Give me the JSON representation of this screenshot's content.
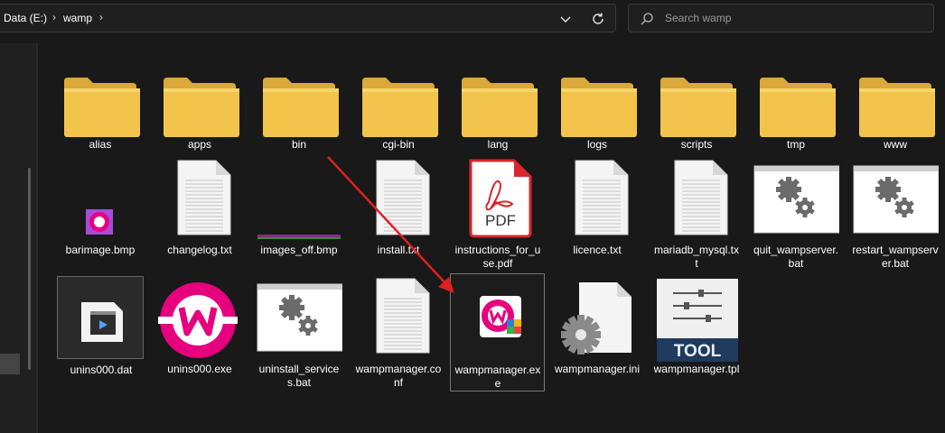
{
  "address_bar": {
    "drive_label": "Data (E:)",
    "folder_label": "wamp",
    "separator": "›"
  },
  "search": {
    "placeholder": "Search wamp"
  },
  "items": [
    {
      "name": "alias",
      "type": "folder"
    },
    {
      "name": "apps",
      "type": "folder"
    },
    {
      "name": "bin",
      "type": "folder"
    },
    {
      "name": "cgi-bin",
      "type": "folder"
    },
    {
      "name": "lang",
      "type": "folder"
    },
    {
      "name": "logs",
      "type": "folder"
    },
    {
      "name": "scripts",
      "type": "folder"
    },
    {
      "name": "tmp",
      "type": "folder"
    },
    {
      "name": "www",
      "type": "folder"
    },
    {
      "name": "barimage.bmp",
      "type": "bmp-wamp"
    },
    {
      "name": "changelog.txt",
      "type": "text"
    },
    {
      "name": "images_off.bmp",
      "type": "bmp-strip"
    },
    {
      "name": "install.txt",
      "type": "text"
    },
    {
      "name": "instructions_for_use.pdf",
      "type": "pdf",
      "badge": "PDF"
    },
    {
      "name": "licence.txt",
      "type": "text"
    },
    {
      "name": "mariadb_mysql.txt",
      "type": "text"
    },
    {
      "name": "quit_wampserver.bat",
      "type": "batch"
    },
    {
      "name": "restart_wampserver.bat",
      "type": "batch"
    },
    {
      "name": "unins000.dat",
      "type": "video"
    },
    {
      "name": "unins000.exe",
      "type": "wamp-logo"
    },
    {
      "name": "uninstall_services.bat",
      "type": "batch"
    },
    {
      "name": "wampmanager.conf",
      "type": "text"
    },
    {
      "name": "wampmanager.exe",
      "type": "wamp-app"
    },
    {
      "name": "wampmanager.ini",
      "type": "ini"
    },
    {
      "name": "wampmanager.tpl",
      "type": "tool",
      "badge": "TOOL"
    }
  ],
  "colors": {
    "background": "#191919",
    "folder": "#f3c44b",
    "wamp_pink": "#e6007e",
    "pdf_red": "#d9262c",
    "arrow": "#e02020"
  }
}
